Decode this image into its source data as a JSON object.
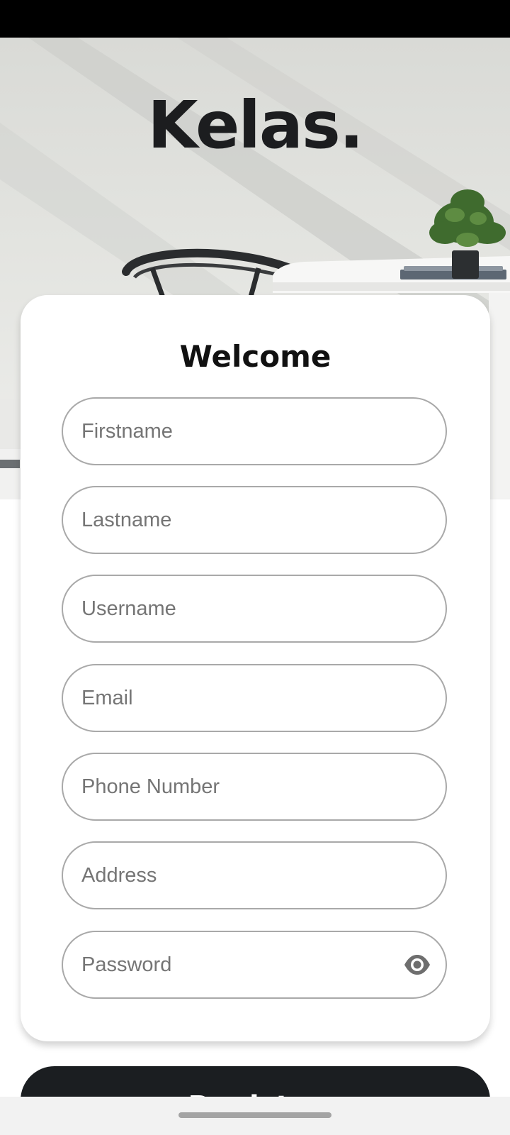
{
  "app": {
    "brand": "Kelas."
  },
  "form": {
    "title": "Welcome",
    "fields": {
      "firstname": {
        "placeholder": "Firstname",
        "value": ""
      },
      "lastname": {
        "placeholder": "Lastname",
        "value": ""
      },
      "username": {
        "placeholder": "Username",
        "value": ""
      },
      "email": {
        "placeholder": "Email",
        "value": ""
      },
      "phone": {
        "placeholder": "Phone Number",
        "value": ""
      },
      "address": {
        "placeholder": "Address",
        "value": ""
      },
      "password": {
        "placeholder": "Password",
        "value": ""
      }
    },
    "password_toggle_icon": "eye-icon",
    "submit_label": "Register"
  },
  "colors": {
    "primary": "#1b1e21",
    "field_border": "#a9a9a9",
    "placeholder": "#757575"
  }
}
